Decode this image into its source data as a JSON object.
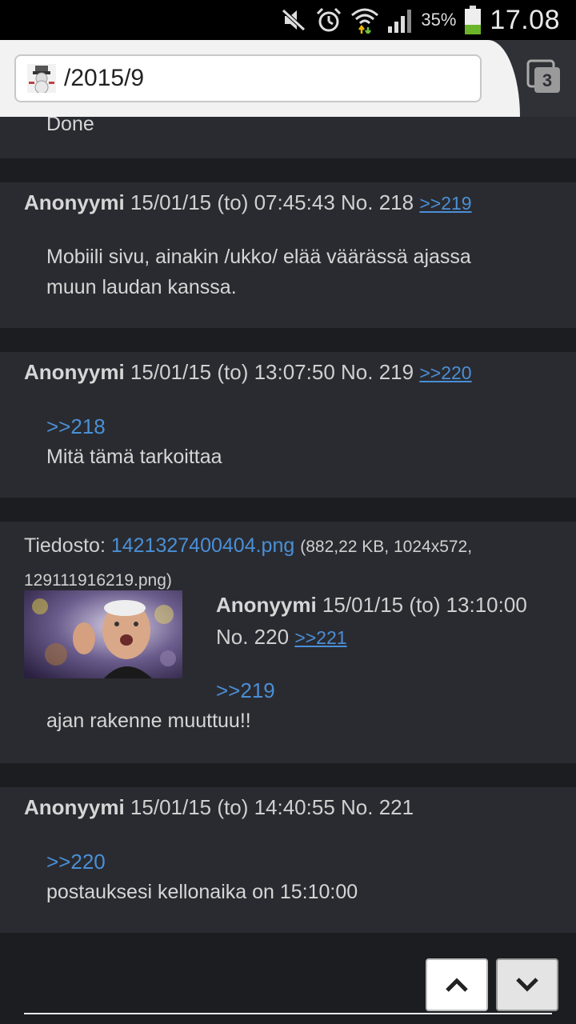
{
  "status": {
    "battery": "35%",
    "time": "17.08"
  },
  "browser": {
    "url": "/2015/9",
    "tab_count": "3"
  },
  "posts": [
    {
      "body_lines": [
        "Done"
      ]
    },
    {
      "name": "Anonyymi",
      "date": "15/01/15 (to) 07:45:43",
      "no": "No. 218",
      "reply": ">>219",
      "body_lines": [
        "Mobiili sivu, ainakin /ukko/ elää väärässä ajassa",
        "muun laudan kanssa."
      ]
    },
    {
      "name": "Anonyymi",
      "date": "15/01/15 (to) 13:07:50",
      "no": "No. 219",
      "reply": ">>220",
      "quote": ">>218",
      "body_lines": [
        "Mitä tämä tarkoittaa"
      ]
    },
    {
      "file_label": "Tiedosto:",
      "file_name": "1421327400404.png",
      "file_meta": "(882,22 KB, 1024x572,",
      "file_meta2": "129111916219.png)",
      "name": "Anonyymi",
      "date": "15/01/15 (to) 13:10:00",
      "no": "No. 220",
      "reply": ">>221",
      "quote": ">>219",
      "body_lines": [
        "ajan rakenne muuttuu!!"
      ]
    },
    {
      "name": "Anonyymi",
      "date": "15/01/15 (to) 14:40:55",
      "no": "No. 221",
      "quote": ">>220",
      "body_lines": [
        "postauksesi kellonaika on 15:10:00"
      ]
    }
  ],
  "icons": {
    "mute": "mute-icon",
    "alarm": "alarm-icon",
    "wifi": "wifi-icon",
    "signal": "signal-icon",
    "battery": "battery-icon",
    "up": "chevron-up-icon",
    "down": "chevron-down-icon"
  },
  "colors": {
    "link": "#4a8fd6",
    "post_bg": "#2a2b30",
    "page_bg": "#1c1d21"
  }
}
